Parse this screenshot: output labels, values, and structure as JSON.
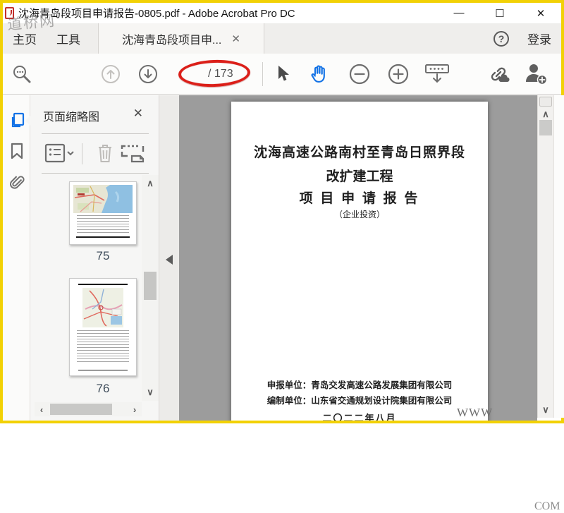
{
  "window": {
    "title": "沈海青岛段项目申请报告-0805.pdf - Adobe Acrobat Pro DC",
    "minimize": "—",
    "maximize": "☐",
    "close": "✕"
  },
  "watermarks": {
    "top_left": "道桥网",
    "doc_left": "WWW",
    "doc_right": "COM"
  },
  "menubar": {
    "home": "主页",
    "tools": "工具",
    "document_tab": "沈海青岛段项目申...",
    "tab_close": "✕",
    "help": "?",
    "sign_in": "登录"
  },
  "toolbar": {
    "page_total": "/ 173"
  },
  "sidebar": {
    "panel_title": "页面缩略图",
    "panel_close": "✕",
    "page_labels": [
      "75",
      "76"
    ]
  },
  "document": {
    "title_line1": "沈海高速公路南村至青岛日照界段",
    "title_line2": "改扩建工程",
    "title_line3": "项 目 申 请 报 告",
    "subtitle": "（企业投资）",
    "applicant_line": "申报单位：青岛交发高速公路发展集团有限公司",
    "compiler_line": "编制单位：山东省交通规划设计院集团有限公司",
    "date_line": "二〇二二年八月"
  },
  "colors": {
    "accent_blue": "#1473e6",
    "annotation_red": "#db1f19",
    "window_border": "#f2d105"
  }
}
